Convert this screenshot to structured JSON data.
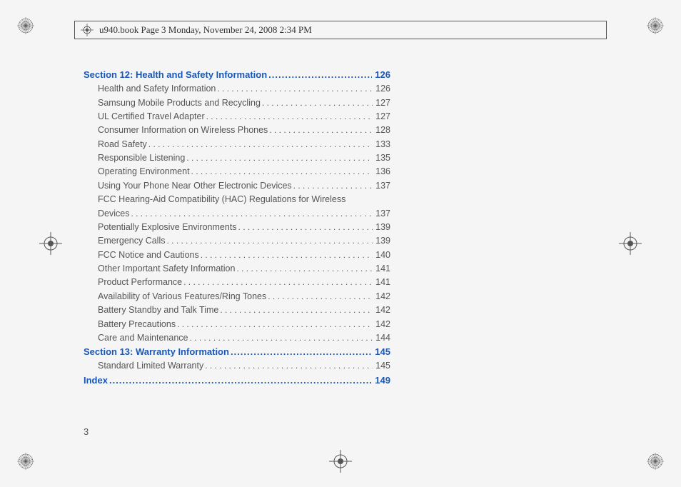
{
  "header": "u940.book  Page 3  Monday, November 24, 2008  2:34 PM",
  "page_number": "3",
  "toc": [
    {
      "type": "section",
      "label": "Section 12:  Health and Safety Information ",
      "page": "126"
    },
    {
      "type": "entry",
      "label": "Health and Safety Information",
      "page": "126"
    },
    {
      "type": "entry",
      "label": "Samsung Mobile Products and Recycling ",
      "page": "127"
    },
    {
      "type": "entry",
      "label": "UL Certified Travel Adapter ",
      "page": "127"
    },
    {
      "type": "entry",
      "label": "Consumer Information on Wireless Phones ",
      "page": "128"
    },
    {
      "type": "entry",
      "label": "Road Safety  ",
      "page": "133"
    },
    {
      "type": "entry",
      "label": "Responsible Listening",
      "page": "135"
    },
    {
      "type": "entry",
      "label": "Operating Environment ",
      "page": "136"
    },
    {
      "type": "entry",
      "label": "Using Your Phone Near Other Electronic Devices  ",
      "page": "137"
    },
    {
      "type": "entry-wrap",
      "label1": "FCC Hearing-Aid Compatibility (HAC) Regulations for Wireless",
      "label2": "Devices  ",
      "page": "137"
    },
    {
      "type": "entry",
      "label": "Potentially Explosive Environments ",
      "page": "139"
    },
    {
      "type": "entry",
      "label": "Emergency Calls",
      "page": "139"
    },
    {
      "type": "entry",
      "label": "FCC Notice and Cautions  ",
      "page": "140"
    },
    {
      "type": "entry",
      "label": "Other Important Safety Information ",
      "page": "141"
    },
    {
      "type": "entry",
      "label": "Product Performance  ",
      "page": "141"
    },
    {
      "type": "entry",
      "label": "Availability of Various Features/Ring Tones ",
      "page": "142"
    },
    {
      "type": "entry",
      "label": "Battery Standby and Talk Time ",
      "page": "142"
    },
    {
      "type": "entry",
      "label": "Battery Precautions  ",
      "page": "142"
    },
    {
      "type": "entry",
      "label": "Care and Maintenance ",
      "page": "144"
    },
    {
      "type": "section",
      "label": "Section 13:  Warranty Information  ",
      "page": "145"
    },
    {
      "type": "entry",
      "label": "Standard Limited Warranty ",
      "page": "145"
    },
    {
      "type": "section",
      "label": "Index ",
      "page": "149"
    }
  ]
}
